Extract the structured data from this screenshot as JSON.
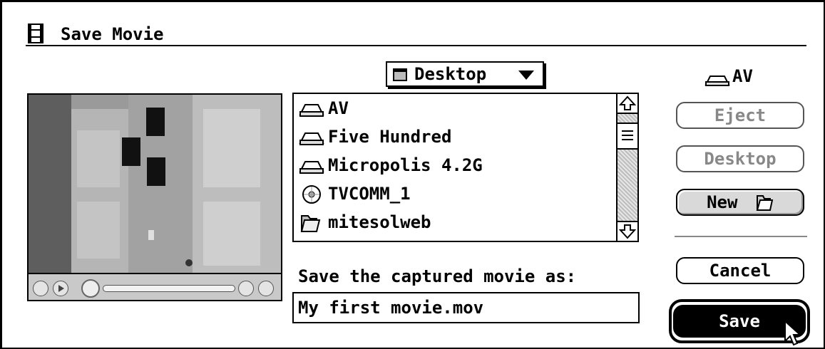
{
  "window": {
    "title": "Save Movie"
  },
  "location_popup": {
    "label": "Desktop"
  },
  "current_volume": {
    "label": "AV"
  },
  "file_list": {
    "items": [
      {
        "label": "AV",
        "icon": "hard-disk-icon"
      },
      {
        "label": "Five Hundred",
        "icon": "hard-disk-icon"
      },
      {
        "label": "Micropolis 4.2G",
        "icon": "hard-disk-icon"
      },
      {
        "label": "TVCOMM_1",
        "icon": "cd-rom-icon"
      },
      {
        "label": "mitesolweb",
        "icon": "folder-icon"
      }
    ]
  },
  "buttons": {
    "eject": "Eject",
    "desktop": "Desktop",
    "new": "New",
    "cancel": "Cancel",
    "save": "Save"
  },
  "save_prompt": "Save the captured movie as:",
  "filename": {
    "value": "My first movie.mov"
  },
  "colors": {
    "frame": "#000000",
    "background": "#ffffff",
    "disabled": "#888888"
  }
}
